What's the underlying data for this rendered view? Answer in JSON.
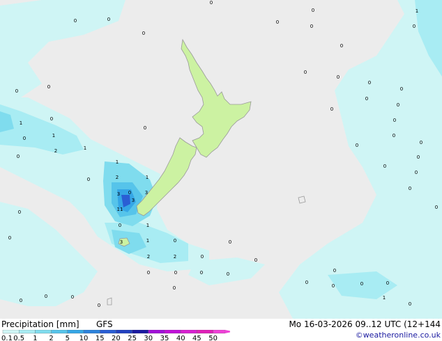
{
  "legend": {
    "title": "Precipitation [mm]",
    "model": "GFS",
    "valid": "Mo 16-03-2026 09..12 UTC (12+144",
    "credit": "©weatheronline.co.uk",
    "scale": [
      "0.1",
      "0.5",
      "1",
      "2",
      "5",
      "10",
      "15",
      "20",
      "25",
      "30",
      "35",
      "40",
      "45",
      "50"
    ],
    "colors": [
      "#cff5f5",
      "#a8ecf3",
      "#7fdcee",
      "#56c4ea",
      "#35a6e6",
      "#2c82dc",
      "#2a5ed4",
      "#2140c0",
      "#1a1aa0",
      "#a010d8",
      "#c010d8",
      "#d820d0",
      "#e020b8",
      "#f040d8"
    ]
  },
  "map": {
    "sea_color": "#ececec",
    "land_color": "#ccf2a2",
    "coast_color": "#9a9a9a",
    "point_values": [
      "0",
      "0",
      "0",
      "0",
      "0",
      "0",
      "0",
      "1",
      "0",
      "0",
      "0",
      "0",
      "0",
      "0",
      "0",
      "0",
      "0",
      "0",
      "0",
      "0",
      "0",
      "0",
      "0",
      "0",
      "0",
      "0",
      "0",
      "0",
      "0",
      "1",
      "0",
      "0",
      "0",
      "0",
      "1",
      "1",
      "0",
      "2",
      "1",
      "1",
      "0",
      "2",
      "3",
      "0",
      "3",
      "3",
      "11",
      "0",
      "1",
      "3",
      "1",
      "0",
      "0",
      "0",
      "2",
      "2",
      "0",
      "0",
      "0",
      "0",
      "0",
      "0",
      "0",
      "0",
      "0",
      "0",
      "0",
      "0",
      "0",
      "0",
      "1",
      "0",
      "0"
    ]
  }
}
